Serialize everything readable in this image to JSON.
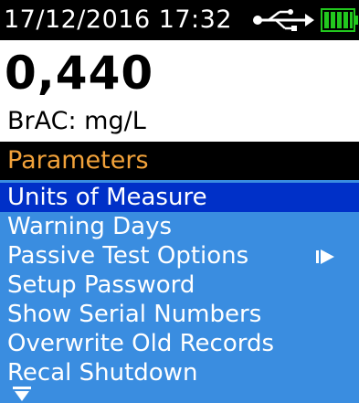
{
  "status": {
    "datetime": "17/12/2016  17:32",
    "usb_icon": "usb-icon",
    "battery_icon": "battery-full-icon",
    "battery_color": "#22c81e"
  },
  "reading": {
    "value": "0,440",
    "unit": "BrAC: mg/L"
  },
  "menu": {
    "title": "Parameters",
    "title_color": "#f2a23a",
    "list_bg_color": "#3a8de0",
    "selected_bg_color": "#0030c8",
    "items": [
      {
        "label": "Units of Measure",
        "selected": true
      },
      {
        "label": "Warning Days",
        "selected": false
      },
      {
        "label": "Passive Test Options",
        "selected": false,
        "has_submenu": true
      },
      {
        "label": "Setup Password",
        "selected": false
      },
      {
        "label": "Show Serial Numbers",
        "selected": false
      },
      {
        "label": "Overwrite Old Records",
        "selected": false
      },
      {
        "label": "Recal Shutdown",
        "selected": false
      }
    ],
    "more_icon": "chevron-down-icon"
  }
}
